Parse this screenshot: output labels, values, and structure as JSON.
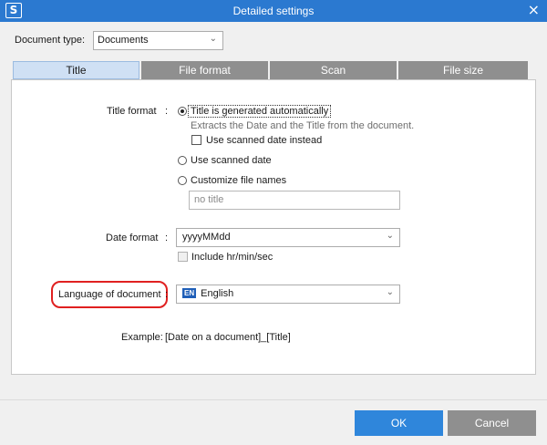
{
  "window": {
    "title": "Detailed settings",
    "app_icon_glyph": "S",
    "close_glyph": "×"
  },
  "document_type": {
    "label": "Document type:",
    "value": "Documents"
  },
  "tabs": [
    {
      "label": "Title",
      "active": true
    },
    {
      "label": "File format",
      "active": false
    },
    {
      "label": "Scan",
      "active": false
    },
    {
      "label": "File size",
      "active": false
    }
  ],
  "title_format": {
    "label": "Title format",
    "colon": ":",
    "options": [
      {
        "label": "Title is generated automatically",
        "selected": true
      },
      {
        "label": "Use scanned date",
        "selected": false
      },
      {
        "label": "Customize file names",
        "selected": false
      }
    ],
    "auto_description": "Extracts the Date and the Title from the document.",
    "use_scanned_date_checkbox": {
      "label": "Use scanned date instead",
      "checked": false
    },
    "custom_name_placeholder": "no title"
  },
  "date_format": {
    "label": "Date format",
    "colon": ":",
    "value": "yyyyMMdd",
    "include_time_checkbox": {
      "label": "Include hr/min/sec",
      "checked": false,
      "enabled": false
    }
  },
  "language": {
    "label": "Language of document",
    "colon": ":",
    "badge": "EN",
    "value": "English"
  },
  "example": {
    "label": "Example:",
    "value": "[Date on a document]_[Title]"
  },
  "buttons": {
    "ok": "OK",
    "cancel": "Cancel"
  },
  "colors": {
    "titlebar": "#2b79d0",
    "ok_button": "#2f86db",
    "highlight_ring": "#e02020",
    "inactive_tab": "#8f8f8f"
  },
  "icons": {
    "app": "scansnap-logo-icon",
    "close": "close-icon",
    "dropdown": "chevron-down-icon",
    "language": "en-flag-icon"
  }
}
